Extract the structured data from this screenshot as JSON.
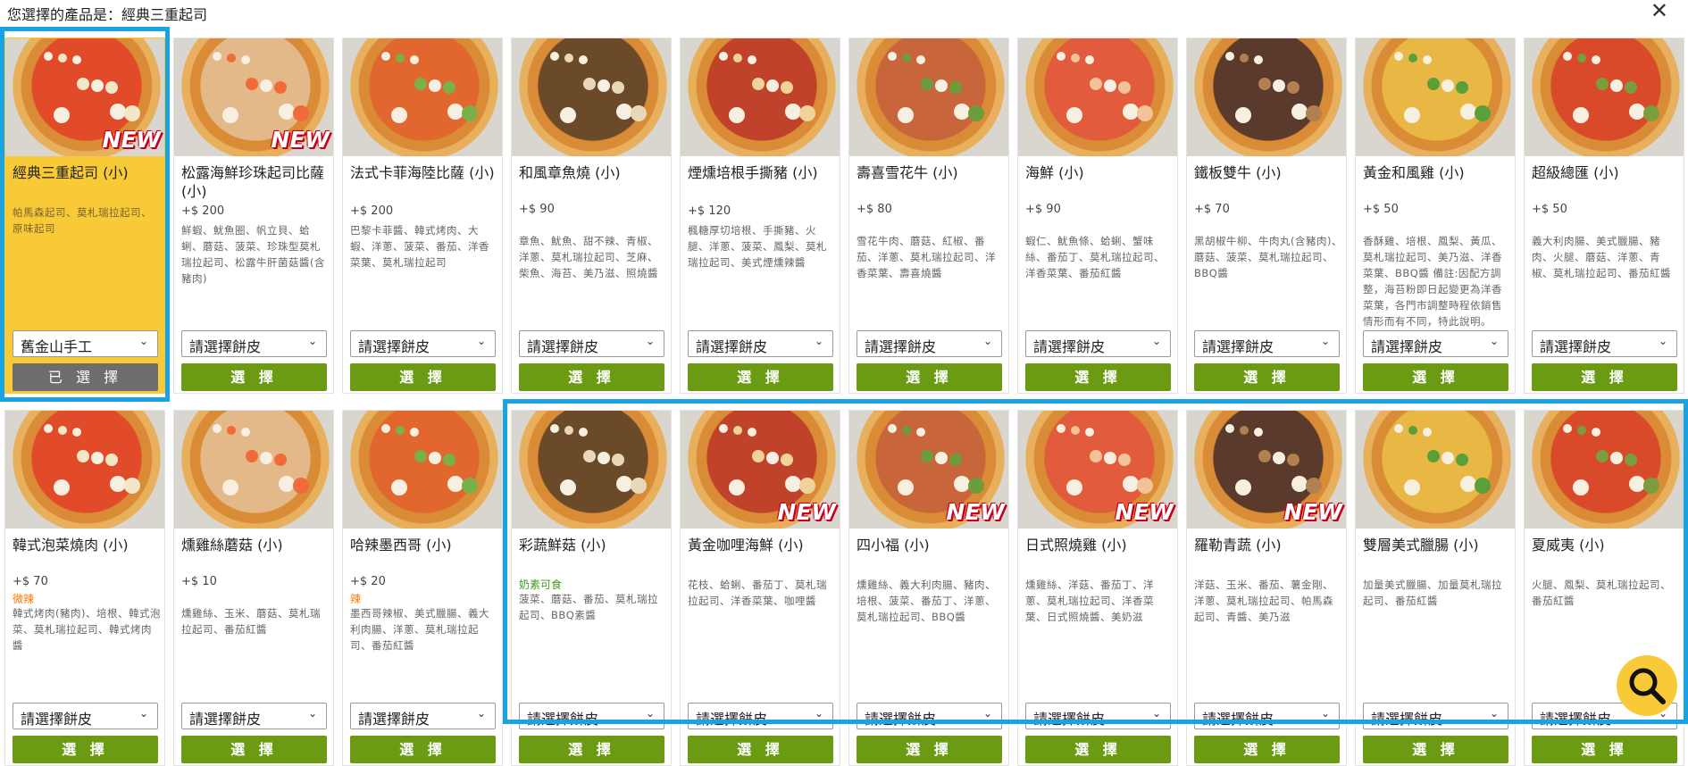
{
  "header": {
    "title": "您選擇的產品是：經典三重起司",
    "close_icon": "close-icon"
  },
  "colors": {
    "selected_card": "#f8ca37",
    "select_button": "#6a9b12",
    "chosen_button": "#6d6d6d",
    "highlight": "#18a3e5",
    "spicy": "#ff7a00",
    "veg": "#3f9b1e"
  },
  "crust_options": {
    "placeholder": "請選擇餅皮",
    "selected_value": "舊金山手工"
  },
  "buttons": {
    "select": "選 擇",
    "selected": "已 選 擇"
  },
  "products": [
    {
      "name": "經典三重起司 (小)",
      "price": "",
      "desc": "帕馬森起司、莫札瑞拉起司、原味起司",
      "new": true,
      "selected": true,
      "crust": "舊金山手工",
      "button": "已 選 擇"
    },
    {
      "name": "松露海鮮珍珠起司比薩 (小)",
      "price": "+$ 200",
      "desc": "鮮蝦、魷魚圈、帆立貝、蛤蜊、蘑菇、菠菜、珍珠型莫札瑞拉起司、松露牛肝菌菇醬(含豬肉)",
      "new": true
    },
    {
      "name": "法式卡菲海陸比薩 (小)",
      "price": "+$ 200",
      "desc": "巴黎卡菲醬、韓式烤肉、大蝦、洋蔥、菠菜、番茄、洋香菜葉、莫札瑞拉起司"
    },
    {
      "name": "和風章魚燒 (小)",
      "price": "+$ 90",
      "desc": "章魚、魷魚、甜不辣、青椒、洋蔥、莫札瑞拉起司、芝麻、柴魚、海苔、美乃滋、照燒醬"
    },
    {
      "name": "煙燻培根手撕豬 (小)",
      "price": "+$ 120",
      "desc": "楓糖厚切培根、手撕豬、火腿、洋蔥、菠菜、鳳梨、莫札瑞拉起司、美式煙燻辣醬"
    },
    {
      "name": "壽喜雪花牛 (小)",
      "price": "+$ 80",
      "desc": "雪花牛肉、蘑菇、紅椒、番茄、洋蔥、莫札瑞拉起司、洋香菜葉、壽喜燒醬"
    },
    {
      "name": "海鮮 (小)",
      "price": "+$ 90",
      "desc": "蝦仁、魷魚條、蛤蜊、蟹味絲、番茄丁、莫札瑞拉起司、洋香菜葉、番茄紅醬"
    },
    {
      "name": "鐵板雙牛 (小)",
      "price": "+$ 70",
      "desc": "黑胡椒牛柳、牛肉丸(含豬肉)、蘑菇、菠菜、莫札瑞拉起司、BBQ醬"
    },
    {
      "name": "黃金和風雞 (小)",
      "price": "+$ 50",
      "desc": "香酥雞、培根、鳳梨、黃瓜、莫札瑞拉起司、美乃滋、洋香菜葉、BBQ醬 備註:因配方調整，海苔粉即日起變更為洋香菜葉，各門市調整時程依銷售情形而有不同，特此說明。"
    },
    {
      "name": "超級總匯 (小)",
      "price": "+$ 50",
      "desc": "義大利肉腸、美式臘腸、豬肉、火腿、蘑菇、洋蔥、青椒、莫札瑞拉起司、番茄紅醬"
    },
    {
      "name": "韓式泡菜燒肉 (小)",
      "price": "+$ 70",
      "tag": "微辣",
      "tag_type": "spicy",
      "desc": "韓式烤肉(豬肉)、培根、韓式泡菜、莫札瑞拉起司、韓式烤肉醬"
    },
    {
      "name": "燻雞絲蘑菇 (小)",
      "price": "+$ 10",
      "desc": "燻雞絲、玉米、蘑菇、莫札瑞拉起司、番茄紅醬"
    },
    {
      "name": "哈辣墨西哥 (小)",
      "price": "+$ 20",
      "tag": "辣",
      "tag_type": "spicy",
      "desc": "墨西哥辣椒、美式臘腸、義大利肉腸、洋蔥、莫札瑞拉起司、番茄紅醬"
    },
    {
      "name": "彩蔬鮮菇 (小)",
      "price": "",
      "tag": "奶素可食",
      "tag_type": "veg",
      "desc": "菠菜、蘑菇、番茄、莫札瑞拉起司、BBQ素醬"
    },
    {
      "name": "黃金咖哩海鮮 (小)",
      "price": "",
      "desc": "花枝、蛤蜊、番茄丁、莫札瑞拉起司、洋香菜葉、咖哩醬",
      "new": true
    },
    {
      "name": "四小福 (小)",
      "price": "",
      "desc": "燻雞絲、義大利肉腸、豬肉、培根、菠菜、番茄丁、洋蔥、莫札瑞拉起司、BBQ醬",
      "new": true
    },
    {
      "name": "日式照燒雞 (小)",
      "price": "",
      "desc": "燻雞絲、洋菇、番茄丁、洋蔥、莫札瑞拉起司、洋香菜葉、日式照燒醬、美奶滋",
      "new": true
    },
    {
      "name": "羅勒青蔬 (小)",
      "price": "",
      "desc": "洋菇、玉米、番茄、薯金剛、洋蔥、莫札瑞拉起司、帕馬森起司、青醬、美乃滋",
      "new": true
    },
    {
      "name": "雙層美式臘腸 (小)",
      "price": "",
      "desc": "加量美式臘腸、加量莫札瑞拉起司、番茄紅醬"
    },
    {
      "name": "夏威夷 (小)",
      "price": "",
      "desc": "火腿、鳳梨、莫札瑞拉起司、番茄紅醬"
    }
  ],
  "zoom_icon": "search-icon"
}
